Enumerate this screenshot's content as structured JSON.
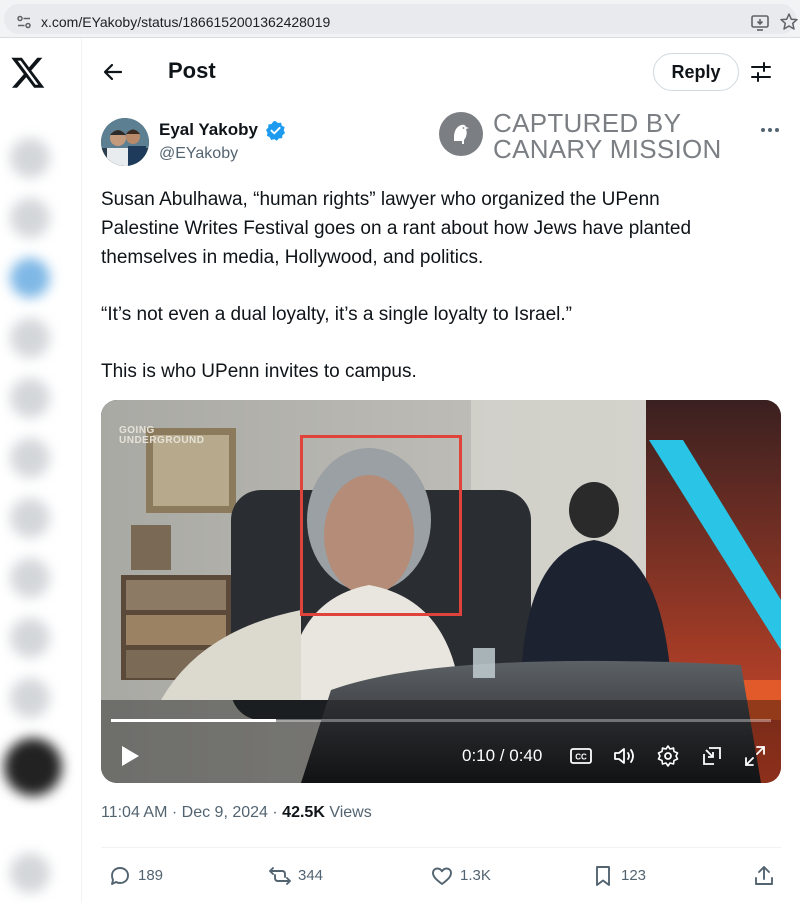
{
  "browser": {
    "url": "x.com/EYakoby/status/1866152001362428019"
  },
  "header": {
    "title": "Post",
    "reply_label": "Reply"
  },
  "author": {
    "name": "Eyal Yakoby",
    "handle": "@EYakoby",
    "verified": true
  },
  "watermark": {
    "line1": "CAPTURED BY",
    "line2": "CANARY MISSION"
  },
  "post": {
    "paragraph1_lines": [
      "Susan Abulhawa, “human rights” lawyer who organized the UPenn",
      "Palestine Writes Festival goes on a rant about how Jews have planted",
      "themselves in media, Hollywood, and politics."
    ],
    "paragraph2": "“It’s not even a dual loyalty, it’s a single loyalty to Israel.”",
    "paragraph3": "This is who UPenn invites to campus."
  },
  "video": {
    "channel_logo_line1": "GOING",
    "channel_logo_line2": "UNDERGROUND",
    "time": "0:10 / 0:40",
    "progress_fraction": 0.25,
    "controls": [
      "play-icon",
      "captions-icon",
      "volume-icon",
      "settings-icon",
      "pop-out-icon",
      "fullscreen-icon"
    ]
  },
  "meta": {
    "time": "11:04 AM",
    "date": "Dec 9, 2024",
    "views_count": "42.5K",
    "views_label": "Views",
    "separator": "·"
  },
  "actions": {
    "replies": "189",
    "reposts": "344",
    "likes": "1.3K",
    "bookmarks": "123"
  },
  "colors": {
    "accent": "#1d9bf0",
    "text_primary": "#0f1419",
    "text_secondary": "#536471",
    "highlight": "#e0423c"
  }
}
